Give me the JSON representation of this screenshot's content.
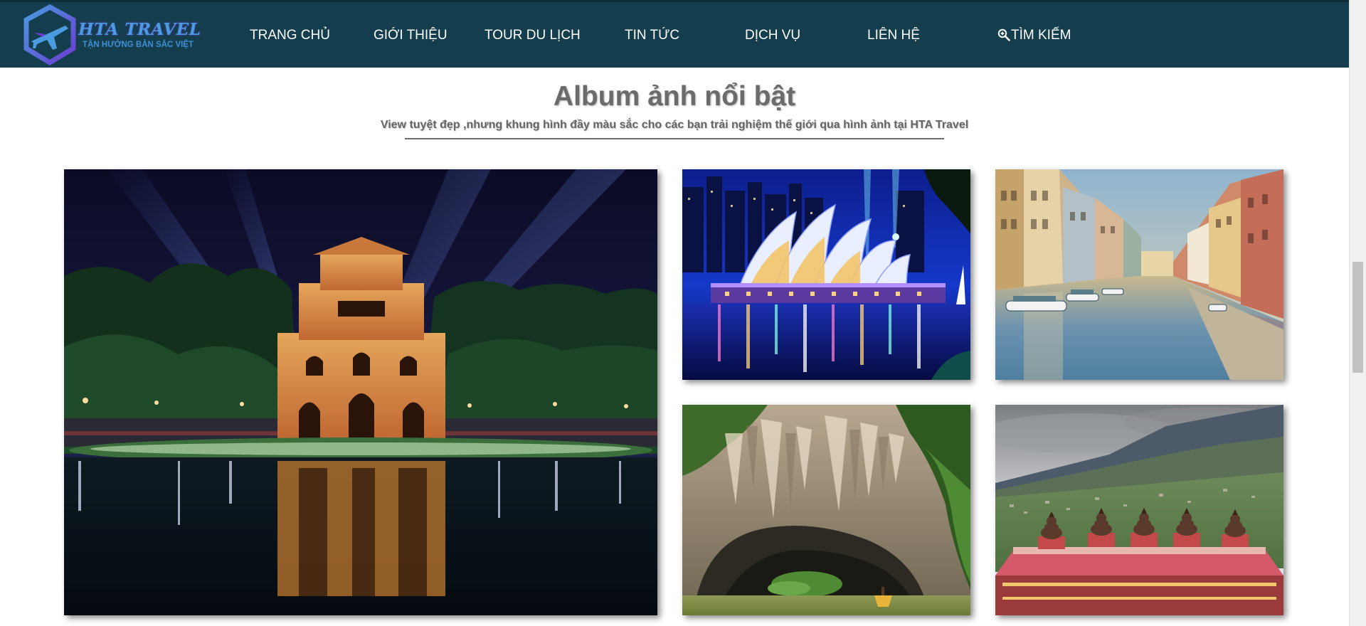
{
  "brand": {
    "name": "HTA TRAVEL",
    "tagline": "TẬN HƯỞNG BẢN SẮC VIỆT",
    "colors": {
      "header_bg": "#143e4d",
      "logo_primary": "#4a9be0",
      "logo_secondary": "#6c3bd2"
    }
  },
  "nav": {
    "items": [
      {
        "label": "TRANG CHỦ"
      },
      {
        "label": "GIỚI THIỆU"
      },
      {
        "label": "TOUR DU LỊCH"
      },
      {
        "label": "TIN TỨC"
      },
      {
        "label": "DỊCH VỤ"
      },
      {
        "label": "LIÊN HỆ"
      }
    ],
    "search": {
      "label": "TÌM KIẾM",
      "icon": "zoom-in-icon"
    }
  },
  "album": {
    "title": "Album ảnh nổi bật",
    "subtitle": "View tuyệt đẹp ,nhưng khung hình đầy màu sắc cho các bạn trải nghiệm thế giới qua hình ảnh tại HTA Travel",
    "photos": [
      {
        "subject": "hoan-kiem-turtle-tower-night"
      },
      {
        "subject": "sydney-opera-house-night"
      },
      {
        "subject": "european-canal-city"
      },
      {
        "subject": "limestone-cave-boat"
      },
      {
        "subject": "mountain-temple-buddha-statues"
      }
    ]
  },
  "scrollbar": {
    "position_fraction": 0.42
  }
}
